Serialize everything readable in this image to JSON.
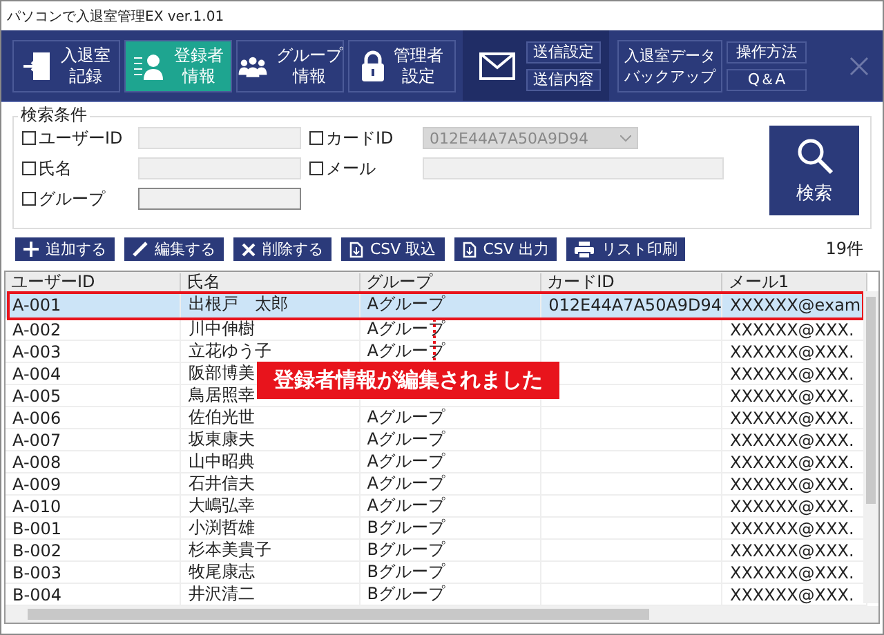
{
  "window": {
    "title": "パソコンで入退室管理EX ver.1.01"
  },
  "nav": [
    {
      "kind": "big",
      "lines": [
        "入退室",
        "記録"
      ],
      "selected": false
    },
    {
      "kind": "big",
      "lines": [
        "登録者",
        "情報"
      ],
      "selected": true
    },
    {
      "kind": "big",
      "lines": [
        "グループ",
        "情報"
      ],
      "selected": false
    },
    {
      "kind": "big",
      "lines": [
        "管理者",
        "設定"
      ],
      "selected": false
    },
    {
      "kind": "mail",
      "buttons": [
        "送信設定",
        "送信内容"
      ]
    },
    {
      "kind": "text",
      "lines": [
        "入退室データ",
        "バックアップ"
      ]
    },
    {
      "kind": "stack",
      "buttons": [
        "操作方法",
        "Q＆A"
      ]
    }
  ],
  "search": {
    "title": "検索条件",
    "button": "検索",
    "left": [
      {
        "label": "ユーザーID",
        "checked": false
      },
      {
        "label": "氏名",
        "checked": false
      },
      {
        "label": "グループ",
        "checked": false
      }
    ],
    "right": [
      {
        "label": "カードID",
        "checked": false,
        "value": "012E44A7A50A9D94",
        "disabled": true
      },
      {
        "label": "メール",
        "checked": false
      }
    ]
  },
  "toolbar": [
    "追加する",
    "編集する",
    "削除する",
    "CSV 取込",
    "CSV 出力",
    "リスト印刷"
  ],
  "count": "19件",
  "table": {
    "columns": [
      "ユーザーID",
      "氏名",
      "グループ",
      "カードID",
      "メール1"
    ],
    "rows": [
      {
        "cells": [
          "A-001",
          "出根戸　太郎",
          "Aグループ",
          "012E44A7A50A9D94",
          "XXXXXX@exam"
        ],
        "selected": true
      },
      {
        "cells": [
          "A-002",
          "川中伸樹",
          "Aグループ",
          null,
          "XXXXXX@XXX."
        ],
        "selected": false
      },
      {
        "cells": [
          "A-003",
          "立花ゆう子",
          "Aグループ",
          null,
          "XXXXXX@XXX."
        ],
        "selected": false
      },
      {
        "cells": [
          "A-004",
          "阪部博美",
          null,
          null,
          "XXXXXX@XXX."
        ],
        "selected": false
      },
      {
        "cells": [
          "A-005",
          "鳥居照幸",
          null,
          null,
          "XXXXXX@XXX."
        ],
        "selected": false
      },
      {
        "cells": [
          "A-006",
          "佐伯光世",
          "Aグループ",
          null,
          "XXXXXX@XXX."
        ],
        "selected": false
      },
      {
        "cells": [
          "A-007",
          "坂東康夫",
          "Aグループ",
          null,
          "XXXXXX@XXX."
        ],
        "selected": false
      },
      {
        "cells": [
          "A-008",
          "山中昭典",
          "Aグループ",
          null,
          "XXXXXX@XXX."
        ],
        "selected": false
      },
      {
        "cells": [
          "A-009",
          "石井信夫",
          "Aグループ",
          null,
          "XXXXXX@XXX."
        ],
        "selected": false
      },
      {
        "cells": [
          "A-010",
          "大嶋弘幸",
          "Aグループ",
          null,
          "XXXXXX@XXX."
        ],
        "selected": false
      },
      {
        "cells": [
          "B-001",
          "小渕哲雄",
          "Bグループ",
          null,
          "XXXXXX@XXX."
        ],
        "selected": false
      },
      {
        "cells": [
          "B-002",
          "杉本美貴子",
          "Bグループ",
          null,
          "XXXXXX@XXX."
        ],
        "selected": false
      },
      {
        "cells": [
          "B-003",
          "牧尾康志",
          "Bグループ",
          null,
          "XXXXXX@XXX."
        ],
        "selected": false
      },
      {
        "cells": [
          "B-004",
          "井沢清二",
          "Bグループ",
          null,
          "XXXXXX@XXX."
        ],
        "selected": false
      }
    ]
  },
  "toast": "登録者情報が編集されました"
}
